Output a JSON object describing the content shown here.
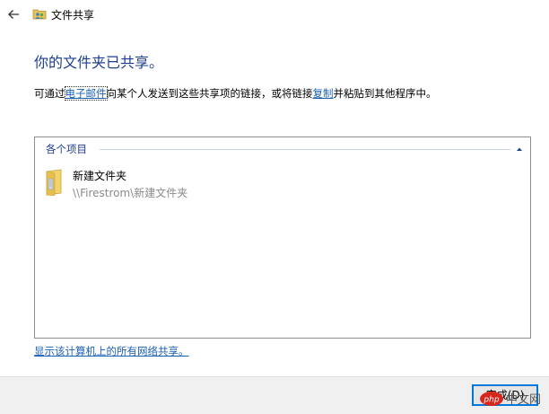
{
  "titlebar": {
    "title": "文件共享",
    "back_icon": "back-arrow-icon",
    "app_icon": "shared-folder-icon"
  },
  "heading": "你的文件夹已共享。",
  "description": {
    "part1": "可通过",
    "email_link": "电子邮件",
    "part2": "向某个人发送到这些共享项的链接，或将链接",
    "copy_link": "复制",
    "part3": "并粘贴到其他程序中。"
  },
  "group": {
    "title": "各个项目",
    "collapse_icon": "chevron-up-icon"
  },
  "items": [
    {
      "name": "新建文件夹",
      "path": "\\\\Firestrom\\新建文件夹",
      "icon": "folder-icon"
    }
  ],
  "show_all_link": "显示该计算机上的所有网络共享。",
  "footer": {
    "done_label": "完成(D)"
  },
  "watermark": {
    "text": "php中文网"
  },
  "colors": {
    "accent": "#0078d7",
    "heading": "#1e3d8f",
    "link": "#1a5fb4",
    "watermark_red": "#d9261c"
  }
}
